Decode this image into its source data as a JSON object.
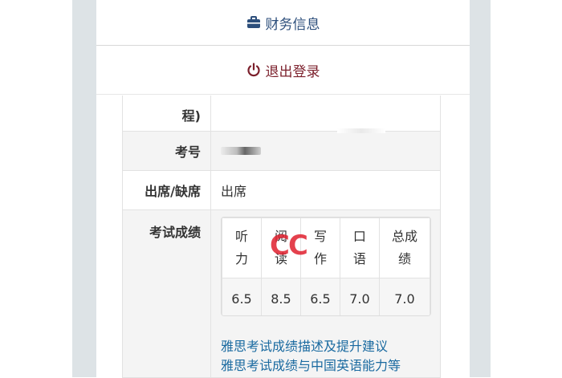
{
  "menu": {
    "finance_label": "财务信息",
    "logout_label": "退出登录"
  },
  "table": {
    "row1_label": "程)",
    "exam_no_label": "考号",
    "attendance_label": "出席/缺席",
    "attendance_value": "出席",
    "scores_label": "考试成绩"
  },
  "scores": {
    "headers": [
      "听力",
      "阅读",
      "写作",
      "口语",
      "总成绩"
    ],
    "values": [
      "6.5",
      "8.5",
      "6.5",
      "7.0",
      "7.0"
    ]
  },
  "watermark": "CC",
  "links": [
    "雅思考试成绩描述及提升建议",
    "雅思考试成绩与中国英语能力等"
  ],
  "icons": {
    "finance": "briefcase-icon",
    "logout": "power-icon"
  },
  "colors": {
    "finance": "#2c4e7b",
    "logout": "#7b1f2b",
    "link": "#1a6aa0",
    "watermark": "#e0202f"
  }
}
